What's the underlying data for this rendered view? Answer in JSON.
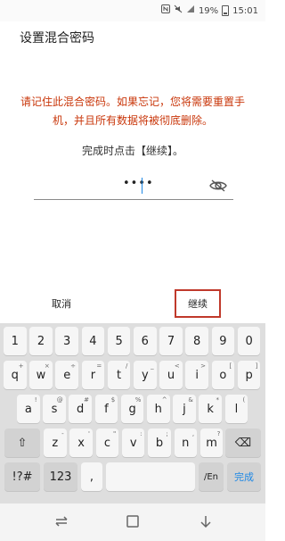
{
  "status": {
    "signal_icon": "nfc-icon",
    "battery_percent": "19%",
    "time": "15:01"
  },
  "header": {
    "title": "设置混合密码"
  },
  "main": {
    "warning": "请记住此混合密码。如果忘记，您将需要重置手机，并且所有数据将被彻底删除。",
    "hint": "完成时点击【继续】。",
    "password_mask": "••••"
  },
  "actions": {
    "cancel": "取消",
    "continue": "继续"
  },
  "keyboard": {
    "row_numbers": [
      "1",
      "2",
      "3",
      "4",
      "5",
      "6",
      "7",
      "8",
      "9",
      "0"
    ],
    "row_q": [
      {
        "k": "q",
        "s": "+"
      },
      {
        "k": "w",
        "s": "×"
      },
      {
        "k": "e",
        "s": "÷"
      },
      {
        "k": "r",
        "s": "="
      },
      {
        "k": "t",
        "s": "/"
      },
      {
        "k": "y",
        "s": "_"
      },
      {
        "k": "u",
        "s": "<"
      },
      {
        "k": "i",
        "s": ">"
      },
      {
        "k": "o",
        "s": "["
      },
      {
        "k": "p",
        "s": "]"
      }
    ],
    "row_a": [
      {
        "k": "a",
        "s": "!"
      },
      {
        "k": "s",
        "s": "@"
      },
      {
        "k": "d",
        "s": "#"
      },
      {
        "k": "f",
        "s": "$"
      },
      {
        "k": "g",
        "s": "%"
      },
      {
        "k": "h",
        "s": "^"
      },
      {
        "k": "j",
        "s": "&"
      },
      {
        "k": "k",
        "s": "*"
      },
      {
        "k": "l",
        "s": "("
      }
    ],
    "row_z": [
      {
        "k": "z",
        "s": "-"
      },
      {
        "k": "x",
        "s": "'"
      },
      {
        "k": "c",
        "s": "\""
      },
      {
        "k": "v",
        "s": ":"
      },
      {
        "k": "b",
        "s": ";"
      },
      {
        "k": "n",
        "s": ","
      },
      {
        "k": "m",
        "s": "?"
      }
    ],
    "shift": "⇧",
    "backspace": "⌫",
    "symbols": "!?#",
    "num": "123",
    "comma": ",",
    "space": "",
    "lang": "/En",
    "period": ".",
    "done": "完成"
  },
  "colors": {
    "warning": "#c9370b",
    "highlight_box": "#c0392b",
    "done_text": "#1e88e5"
  }
}
